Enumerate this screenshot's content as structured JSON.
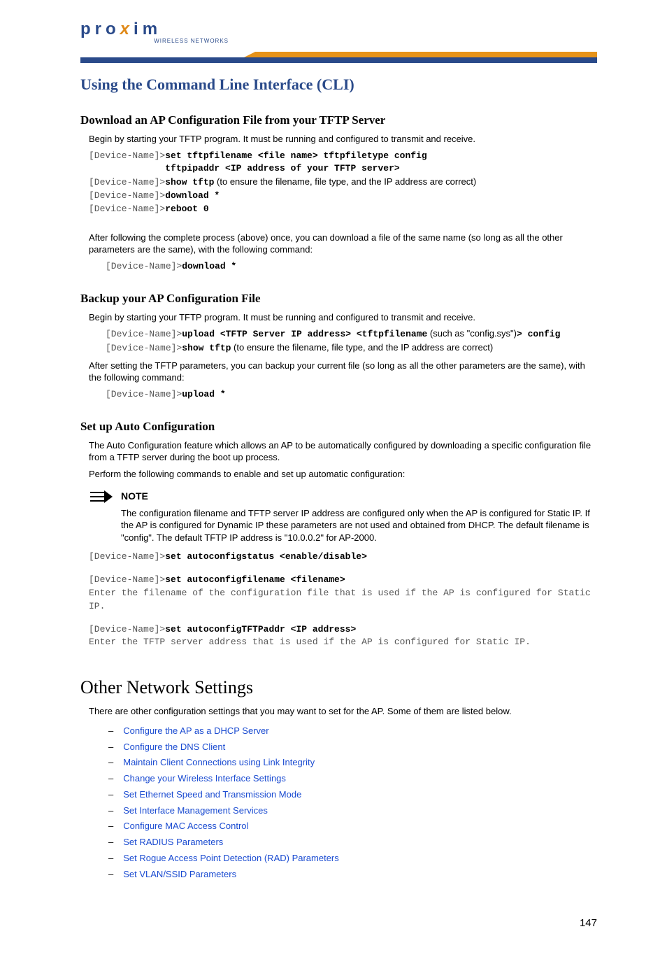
{
  "logo": {
    "brand_pre": "pro",
    "brand_x": "x",
    "brand_post": "im",
    "sub": "WIRELESS NETWORKS"
  },
  "page_title": "Using the Command Line Interface (CLI)",
  "sec1": {
    "title": "Download an AP Configuration File from your TFTP Server",
    "intro": "Begin by starting your TFTP program. It must be running and configured to transmit and receive.",
    "prompt": "[Device-Name]>",
    "cmd1": "set tftpfilename <file name> tftpfiletype config",
    "cmd1b": "tftpipaddr <IP address of your TFTP server>",
    "cmd2": "show tftp",
    "cmd2_ann": " (to ensure the filename, file type, and the IP address are correct)",
    "cmd3": "download *",
    "cmd4": "reboot 0",
    "after": "After following the complete process (above) once, you can download a file of the same name (so long as all the other parameters are the same), with the following command:",
    "cmd5": "download *"
  },
  "sec2": {
    "title": "Backup your AP Configuration File",
    "intro": "Begin by starting your TFTP program. It must be running and configured to transmit and receive.",
    "cmd1": "upload <TFTP Server IP address> <tftpfilename",
    "cmd1_mid": " (such as \"config.sys\")",
    "cmd1_end": "> config",
    "cmd2": "show tftp",
    "cmd2_ann": " (to ensure the filename, file type, and the IP address are correct)",
    "after": "After setting the TFTP parameters, you can backup your current file (so long as all the other parameters are the same), with the following command:",
    "cmd3": "upload *"
  },
  "sec3": {
    "title": "Set up Auto Configuration",
    "intro": "The Auto Configuration feature which allows an AP to be automatically configured by downloading a specific configuration file from a TFTP server during the boot up process.",
    "perform": "Perform the following commands to enable and set up automatic configuration:",
    "note_label": "NOTE",
    "note_body": "The configuration filename and TFTP server IP address are configured only when the AP is configured for Static IP. If the AP is configured for Dynamic IP these parameters are not used and obtained from DHCP. The default filename is \"config\". The default TFTP IP address is \"10.0.0.2\" for AP-2000.",
    "cmdA": "set autoconfigstatus <enable/disable>",
    "cmdB": "set autoconfigfilename <filename>",
    "descB": "Enter the filename of the configuration file that is used if the AP is configured for Static IP.",
    "cmdC": "set autoconfigTFTPaddr <IP address>",
    "descC": "Enter the TFTP server address that is used if the AP is configured for Static IP."
  },
  "sec4": {
    "title": "Other Network Settings",
    "intro": "There are other configuration settings that you may want to set for the AP. Some of them are listed below.",
    "links": [
      "Configure the AP as a DHCP Server",
      "Configure the DNS Client",
      "Maintain Client Connections using Link Integrity",
      "Change your Wireless Interface Settings",
      "Set Ethernet Speed and Transmission Mode",
      "Set Interface Management Services",
      "Configure MAC Access Control",
      "Set RADIUS Parameters",
      "Set Rogue Access Point Detection (RAD) Parameters",
      "Set VLAN/SSID Parameters"
    ]
  },
  "page_number": "147"
}
